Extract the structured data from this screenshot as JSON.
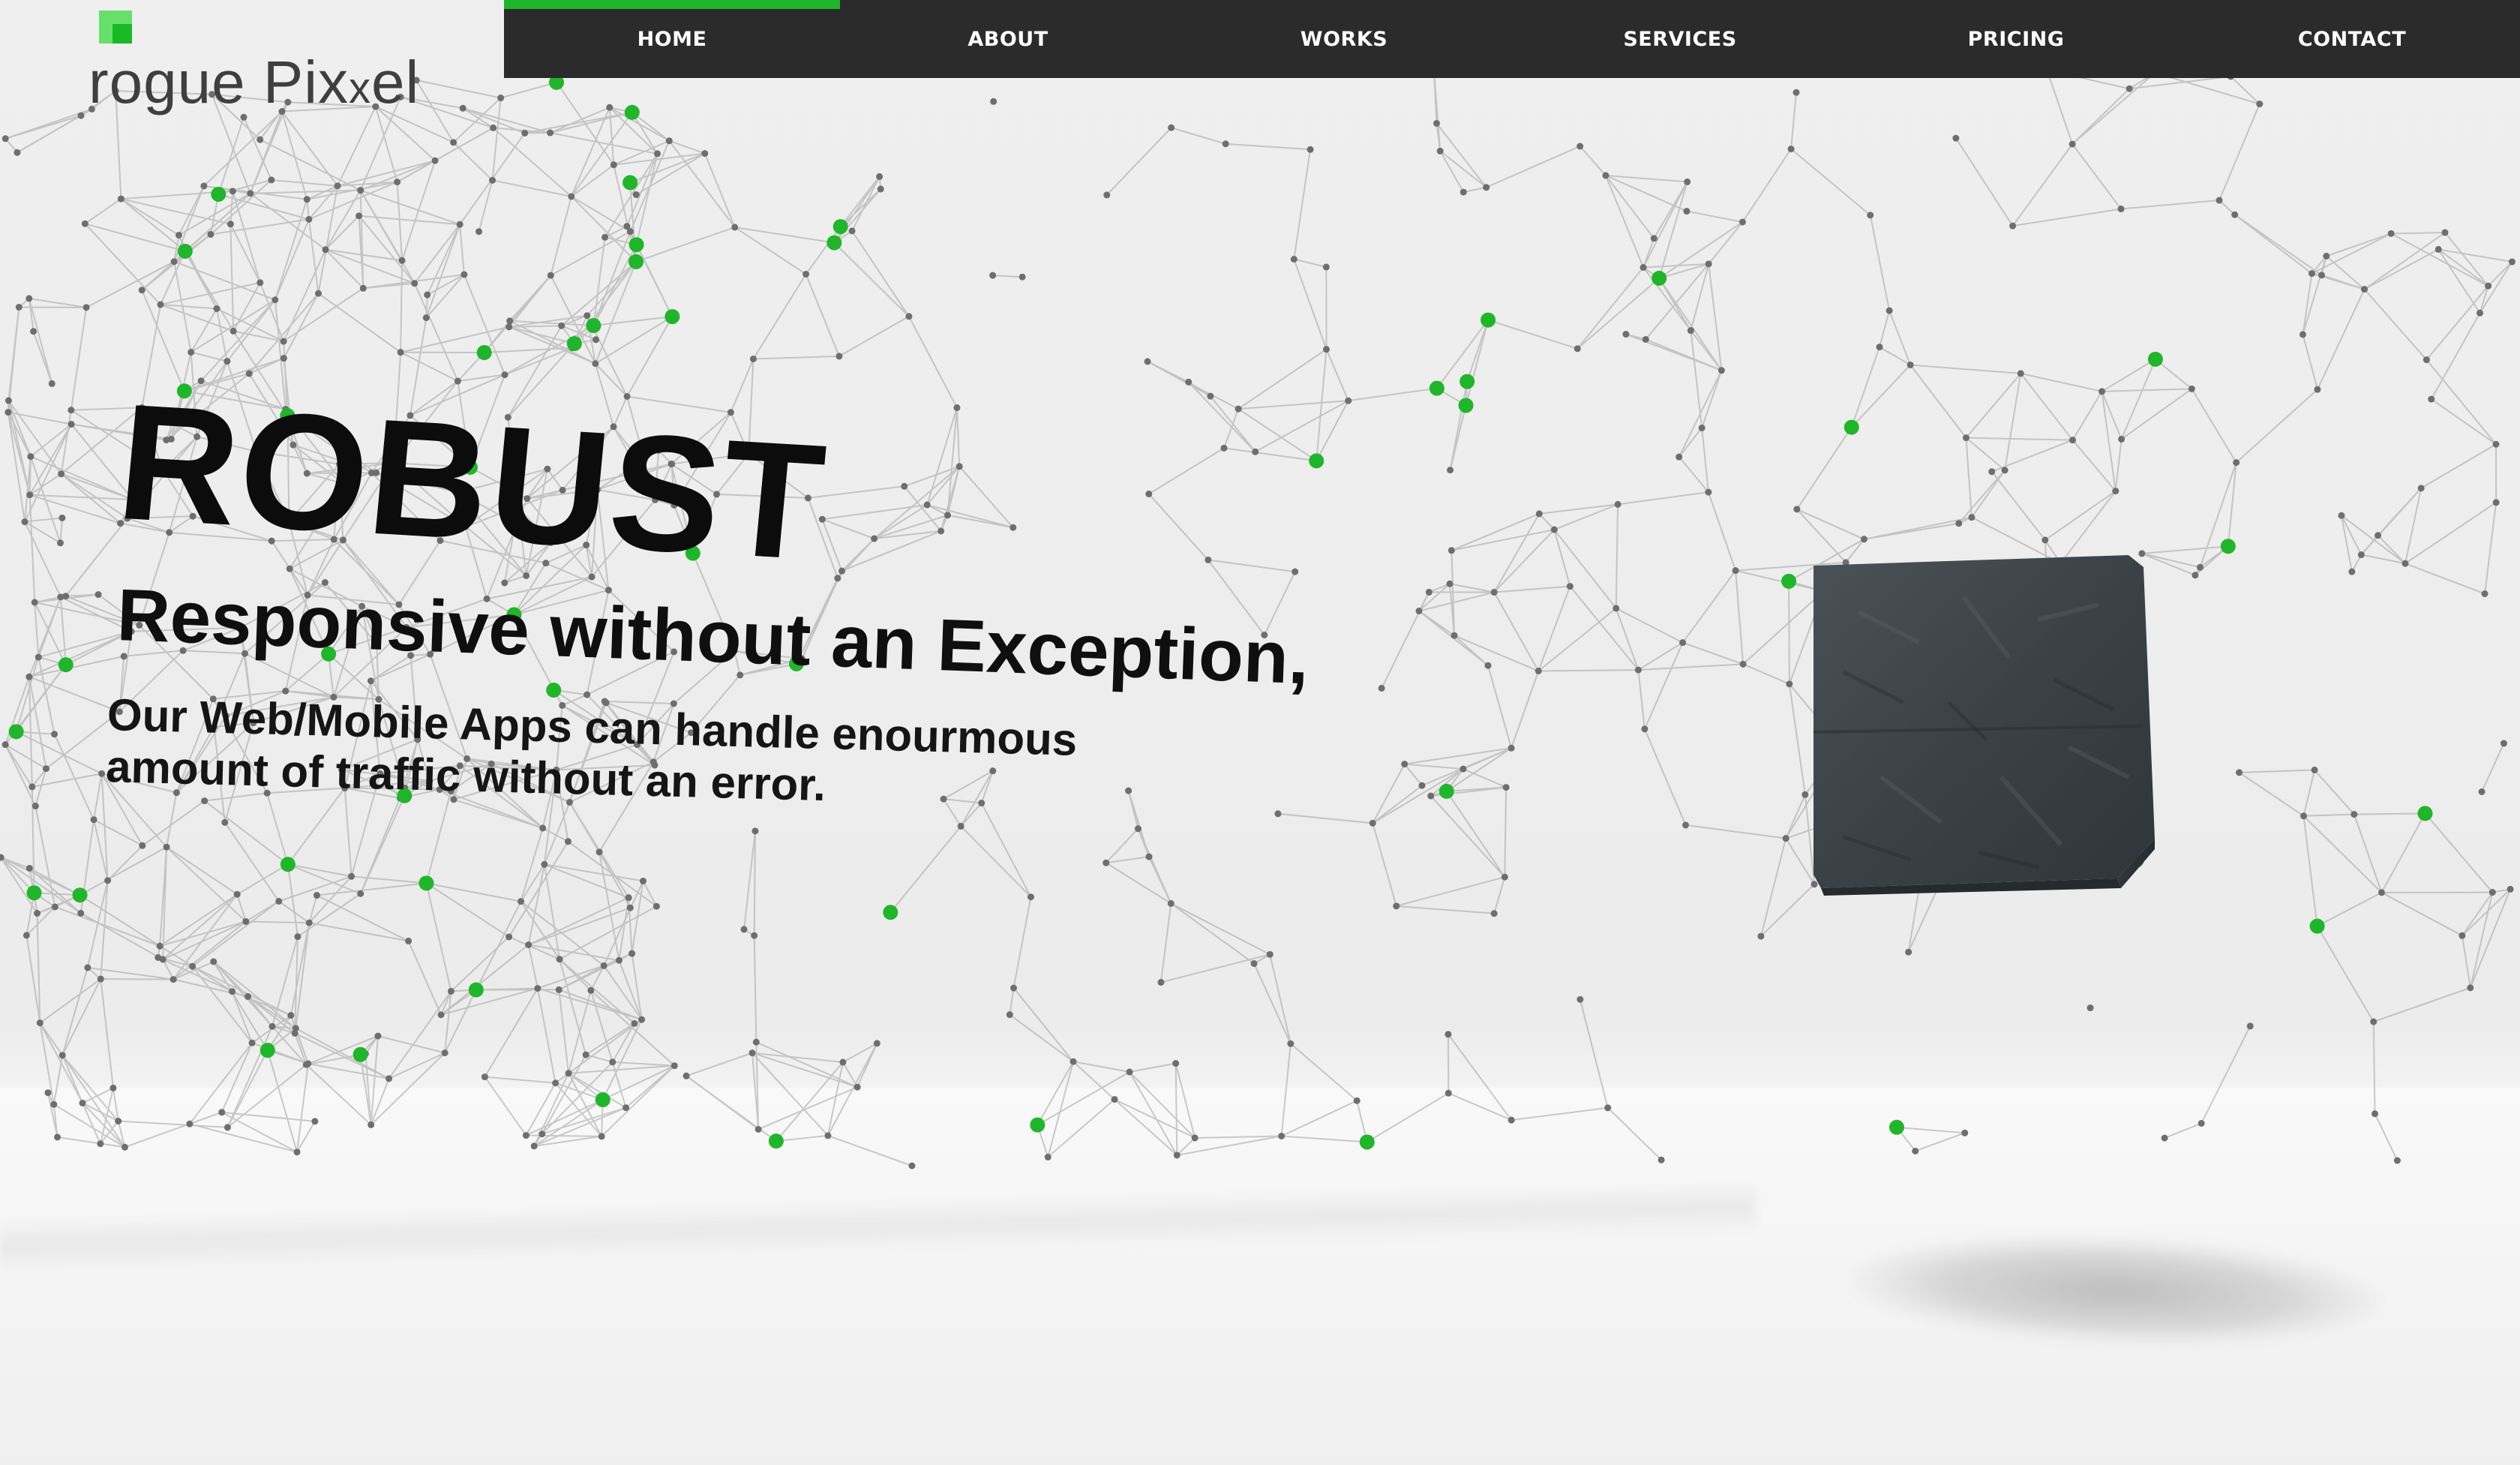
{
  "brand": {
    "logo_text_pre": "rogue Pix",
    "logo_text_x": "x",
    "logo_text_post": "el",
    "accent_color": "#1fb62a",
    "logo_mark_light": "#66e06a",
    "logo_mark_dark": "#19b923"
  },
  "nav": {
    "background": "#2b2b2b",
    "items": [
      {
        "label": "HOME",
        "active": true
      },
      {
        "label": "ABOUT",
        "active": false
      },
      {
        "label": "WORKS",
        "active": false
      },
      {
        "label": "SERVICES",
        "active": false
      },
      {
        "label": "PRICING",
        "active": false
      },
      {
        "label": "CONTACT",
        "active": false
      }
    ]
  },
  "hero": {
    "title": "ROBUST",
    "subtitle": "Responsive without an Exception,",
    "body": "Our Web/Mobile Apps can handle enourmous amount of traffic without an error."
  },
  "scene": {
    "object": "dark-stone-cube",
    "network_node_color": "#1fb62a",
    "network_line_color": "#9a9a9a"
  }
}
